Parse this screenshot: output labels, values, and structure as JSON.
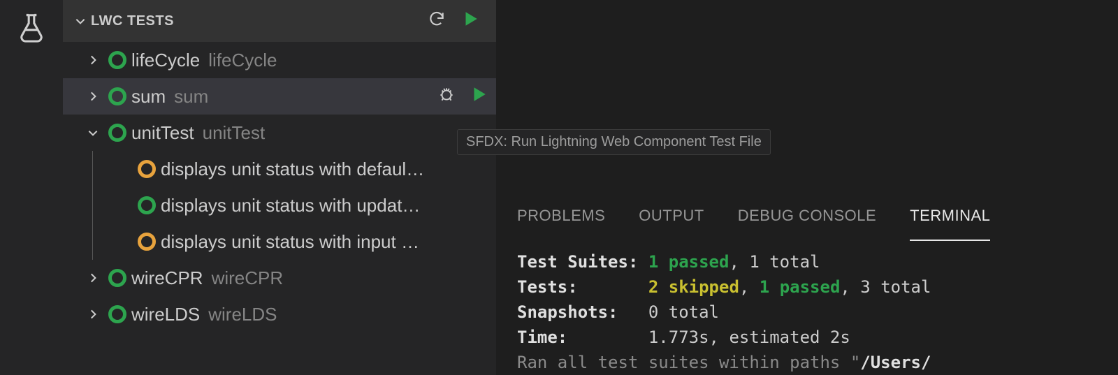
{
  "sidebar": {
    "panel_title": "LWC TESTS",
    "items": [
      {
        "primary": "lifeCycle",
        "secondary": "lifeCycle"
      },
      {
        "primary": "sum",
        "secondary": "sum"
      },
      {
        "primary": "unitTest",
        "secondary": "unitTest"
      },
      {
        "primary": "displays unit status with defaul…"
      },
      {
        "primary": "displays unit status with updat…"
      },
      {
        "primary": "displays unit status with input …"
      },
      {
        "primary": "wireCPR",
        "secondary": "wireCPR"
      },
      {
        "primary": "wireLDS",
        "secondary": "wireLDS"
      }
    ]
  },
  "tooltip": {
    "text": "SFDX: Run Lightning Web Component Test File"
  },
  "panel_tabs": {
    "problems": "PROBLEMS",
    "output": "OUTPUT",
    "debug_console": "DEBUG CONSOLE",
    "terminal": "TERMINAL"
  },
  "terminal": {
    "lines": {
      "l1_label": "Test Suites: ",
      "l1_green": "1 passed",
      "l1_rest": ", 1 total",
      "l2_label": "Tests:       ",
      "l2_yellow": "2 skipped",
      "l2_sep1": ", ",
      "l2_green": "1 passed",
      "l2_rest": ", 3 total",
      "l3_label": "Snapshots:   ",
      "l3_rest": "0 total",
      "l4_label": "Time:        ",
      "l4_rest": "1.773s, estimated 2s",
      "l5_gray_a": "Ran all test suites within paths \"",
      "l5_bold_b": "/Users/"
    }
  }
}
